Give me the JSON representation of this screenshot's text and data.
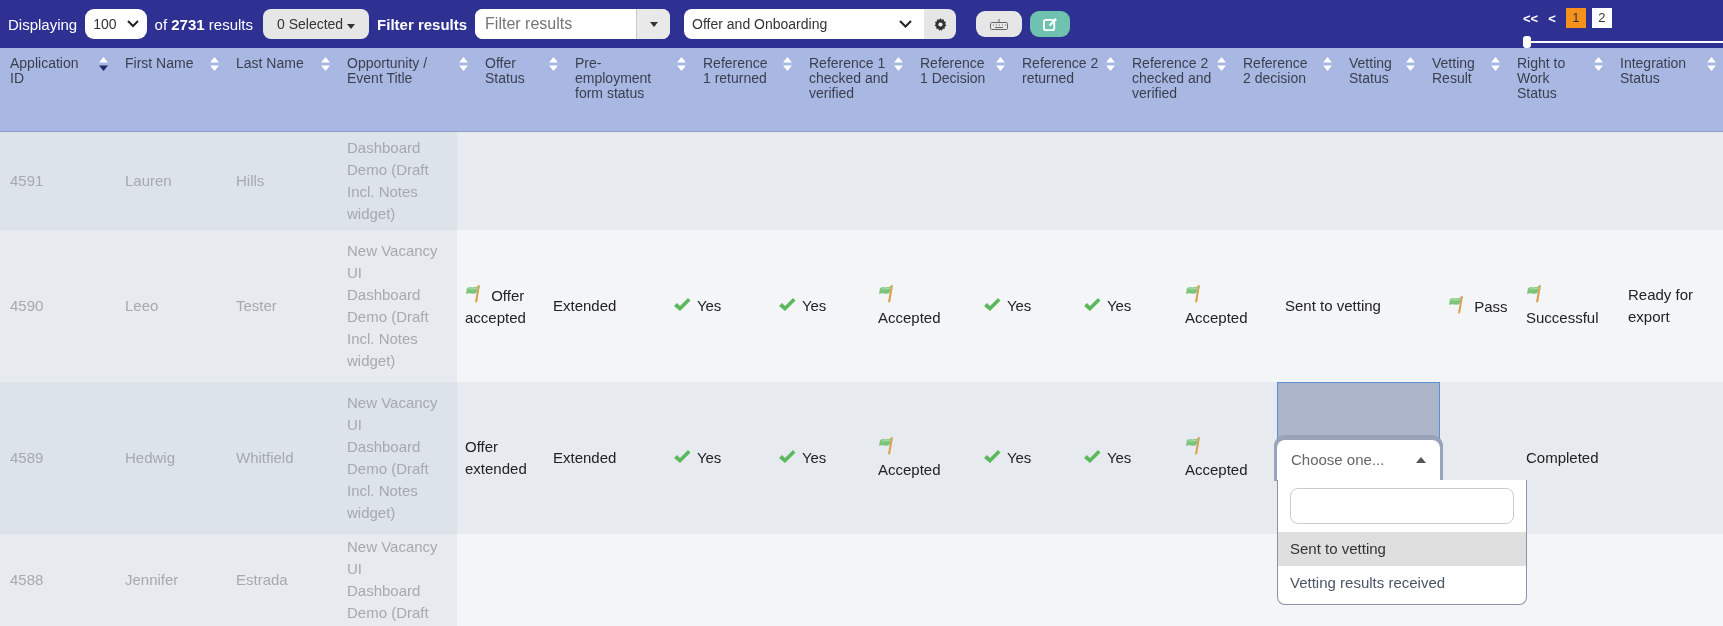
{
  "toolbar": {
    "displaying_label": "Displaying",
    "page_size": "100",
    "results_text": "of **2731** results",
    "selected_button": "0 Selected",
    "filter_label": "Filter results",
    "filter_placeholder": "Filter results",
    "view_select": "Offer and Onboarding"
  },
  "pagination": {
    "first": "<<",
    "prev": "<",
    "pages": [
      {
        "label": "1",
        "selected": true
      },
      {
        "label": "2",
        "selected": false
      }
    ],
    "slider": {
      "level": 0
    }
  },
  "table": {
    "columns": [
      {
        "label": "Application ID",
        "sorted": true
      },
      {
        "label": "First Name",
        "sorted": false
      },
      {
        "label": "Last Name",
        "sorted": false
      },
      {
        "label": "Opportunity / Event Title",
        "sorted": false
      },
      {
        "label": "Offer Status",
        "sorted": false
      },
      {
        "label": "Pre-employment form status",
        "sorted": false
      },
      {
        "label": "Reference 1 returned",
        "sorted": false
      },
      {
        "label": "Reference 1 checked and verified",
        "sorted": false
      },
      {
        "label": "Reference 1 Decision",
        "sorted": false
      },
      {
        "label": "Reference 2 returned",
        "sorted": false
      },
      {
        "label": "Reference 2 checked and verified",
        "sorted": false
      },
      {
        "label": "Reference 2 decision",
        "sorted": false
      },
      {
        "label": "Vetting Status",
        "sorted": false
      },
      {
        "label": "Vetting Result",
        "sorted": false
      },
      {
        "label": "Right to Work Status",
        "sorted": false
      },
      {
        "label": "Integration Status",
        "sorted": false
      }
    ],
    "rows": [
      {
        "id": "4591",
        "first_name": "Lauren",
        "last_name": "Hills",
        "opportunity": "Dashboard Demo (Draft Incl. Notes widget)"
      },
      {
        "id": "4590",
        "first_name": "Leeo",
        "last_name": "Tester",
        "opportunity": "New Vacancy UI Dashboard Demo (Draft Incl. Notes widget)",
        "cells": [
          {
            "kind": "flag",
            "text": "Offer accepted"
          },
          {
            "kind": "text",
            "text": "Extended"
          },
          {
            "kind": "check",
            "text": "Yes"
          },
          {
            "kind": "check",
            "text": "Yes"
          },
          {
            "kind": "flag",
            "text": "Accepted"
          },
          {
            "kind": "check",
            "text": "Yes"
          },
          {
            "kind": "check",
            "text": "Yes"
          },
          {
            "kind": "flag",
            "text": "Accepted"
          },
          {
            "kind": "text",
            "text": "Sent to vetting"
          },
          {
            "kind": "flag",
            "text": "Pass"
          },
          {
            "kind": "flag",
            "text": "Successful"
          },
          {
            "kind": "text",
            "text": "Ready for export"
          }
        ]
      },
      {
        "id": "4589",
        "first_name": "Hedwig",
        "last_name": "Whitfield",
        "opportunity": "New Vacancy UI Dashboard Demo (Draft Incl. Notes widget)",
        "cells": [
          {
            "kind": "text",
            "text": "Offer extended"
          },
          {
            "kind": "text",
            "text": "Extended"
          },
          {
            "kind": "check",
            "text": "Yes"
          },
          {
            "kind": "check",
            "text": "Yes"
          },
          {
            "kind": "flag",
            "text": "Accepted"
          },
          {
            "kind": "check",
            "text": "Yes"
          },
          {
            "kind": "check",
            "text": "Yes"
          },
          {
            "kind": "flag",
            "text": "Accepted"
          },
          {
            "kind": "select",
            "placeholder": "Choose one...",
            "options": [
              {
                "label": "Sent to vetting",
                "selected": true
              },
              {
                "label": "Vetting results received",
                "selected": false
              }
            ]
          },
          {
            "kind": "empty"
          },
          {
            "kind": "text",
            "text": "Completed"
          },
          {
            "kind": "empty"
          }
        ]
      },
      {
        "id": "4588",
        "first_name": "Jennifer",
        "last_name": "Estrada",
        "opportunity": "New Vacancy UI Dashboard Demo (Draft"
      }
    ]
  }
}
